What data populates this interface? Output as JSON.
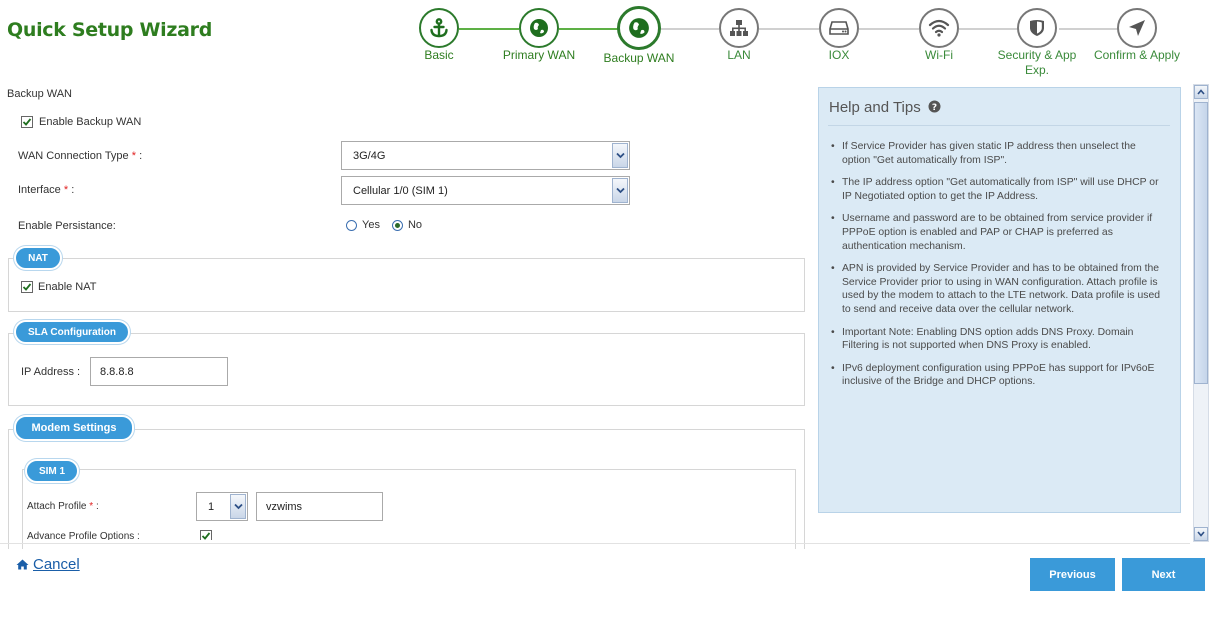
{
  "header": {
    "title": "Quick Setup Wizard"
  },
  "steps": [
    {
      "label": "Basic",
      "icon": "anchor-icon"
    },
    {
      "label": "Primary WAN",
      "icon": "globe-icon"
    },
    {
      "label": "Backup WAN",
      "icon": "globe-icon"
    },
    {
      "label": "LAN",
      "icon": "network-icon"
    },
    {
      "label": "IOX",
      "icon": "storage-icon"
    },
    {
      "label": "Wi-Fi",
      "icon": "wifi-icon"
    },
    {
      "label": "Security & App Exp.",
      "icon": "shield-icon"
    },
    {
      "label": "Confirm & Apply",
      "icon": "location-arrow-icon"
    }
  ],
  "form": {
    "section_title": "Backup WAN",
    "enable_backup_label": "Enable Backup WAN",
    "wan_type_label": "WAN Connection Type",
    "wan_type_value": "3G/4G",
    "interface_label": "Interface",
    "interface_value": "Cellular 1/0 (SIM 1)",
    "persistence_label": "Enable Persistance:",
    "persistence_yes": "Yes",
    "persistence_no": "No",
    "required_mark": "*",
    "colon": " :"
  },
  "nat": {
    "title": "NAT",
    "enable_label": "Enable NAT"
  },
  "sla": {
    "title": "SLA Configuration",
    "ip_label": "IP Address :",
    "ip_value": "8.8.8.8"
  },
  "modem": {
    "title": "Modem Settings",
    "sim_title": "SIM 1",
    "attach_label": "Attach Profile",
    "attach_value": "1",
    "attach_name": "vzwims",
    "advance_label": "Advance Profile Options :"
  },
  "help": {
    "title": "Help and Tips",
    "tips": [
      "If Service Provider has given static IP address then unselect the option \"Get automatically from ISP\".",
      "The IP address option \"Get automatically from ISP\" will use DHCP or IP Negotiated option to get the IP Address.",
      "Username and password are to be obtained from service provider if PPPoE option is enabled and PAP or CHAP is preferred as authentication mechanism.",
      "APN is provided by Service Provider and has to be obtained from the Service Provider prior to using in WAN configuration. Attach profile is used by the modem to attach to the LTE network. Data profile is used to send and receive data over the cellular network.",
      "Important Note: Enabling DNS option adds DNS Proxy. Domain Filtering is not supported when DNS Proxy is enabled.",
      "IPv6 deployment configuration using PPPoE has support for IPv6oE inclusive of the Bridge and DHCP options."
    ]
  },
  "footer": {
    "cancel_label": "Cancel",
    "previous_label": "Previous",
    "next_label": "Next"
  },
  "colors": {
    "brand_green": "#2e7d1f",
    "accent_blue": "#3a9ad9",
    "help_bg": "#dbeaf5"
  }
}
